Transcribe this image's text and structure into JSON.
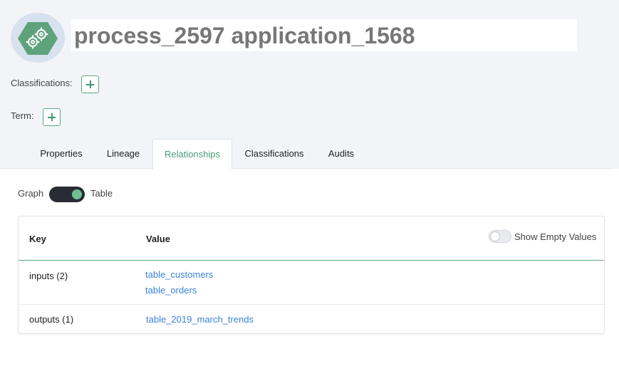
{
  "entity": {
    "icon": "process-gear-icon",
    "title": "process_2597 application_1568"
  },
  "meta": {
    "classifications_label": "Classifications:",
    "term_label": "Term:"
  },
  "tabs": [
    {
      "label": "Properties",
      "active": false
    },
    {
      "label": "Lineage",
      "active": false
    },
    {
      "label": "Relationships",
      "active": true
    },
    {
      "label": "Classifications",
      "active": false
    },
    {
      "label": "Audits",
      "active": false
    }
  ],
  "view_toggle": {
    "left_label": "Graph",
    "right_label": "Table",
    "selected": "Table"
  },
  "table": {
    "headers": {
      "key": "Key",
      "value": "Value"
    },
    "show_empty_label": "Show Empty Values",
    "show_empty_on": false,
    "rows": [
      {
        "key": "inputs (2)",
        "values": [
          "table_customers",
          "table_orders"
        ]
      },
      {
        "key": "outputs (1)",
        "values": [
          "table_2019_march_trends"
        ]
      }
    ]
  },
  "colors": {
    "accent_green": "#4a9b78",
    "link_blue": "#3b82d8",
    "hexagon_green": "#5fa37c"
  }
}
